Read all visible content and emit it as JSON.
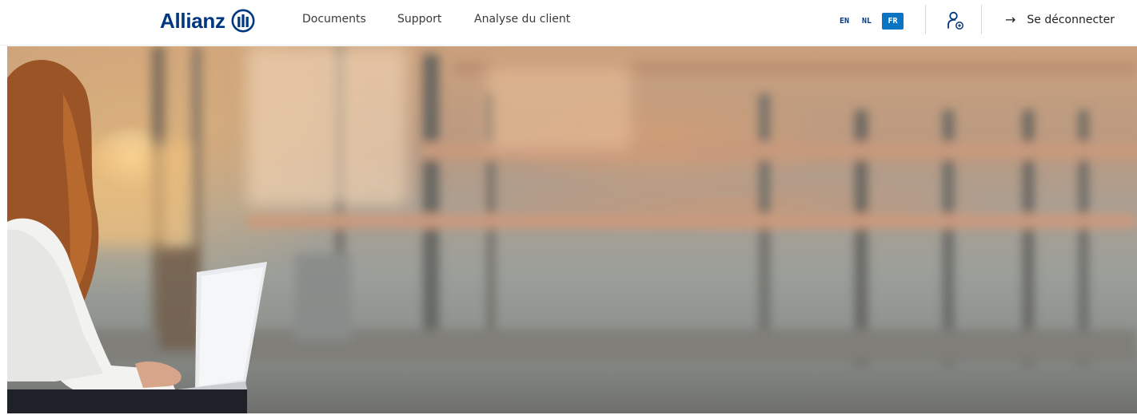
{
  "brand": {
    "name": "Allianz",
    "color": "#003781"
  },
  "nav": {
    "items": [
      {
        "label": "Documents"
      },
      {
        "label": "Support"
      },
      {
        "label": "Analyse du client"
      }
    ]
  },
  "languages": {
    "options": [
      "EN",
      "NL",
      "FR"
    ],
    "active": "FR",
    "active_color": "#0a73c2"
  },
  "user_menu": {
    "icon": "user-settings-icon"
  },
  "logout": {
    "icon": "arrow-right-icon",
    "label": "Se déconnecter"
  },
  "hero": {
    "image": "woman-with-laptop-blurred-building-photo"
  }
}
